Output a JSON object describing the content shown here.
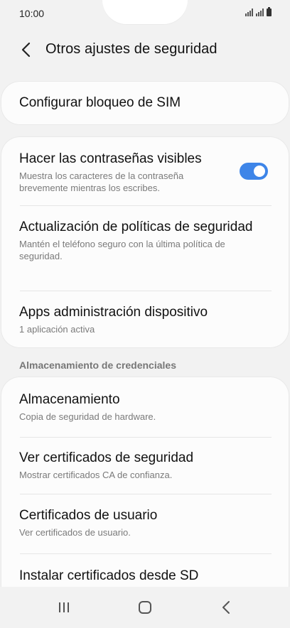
{
  "status_bar": {
    "time": "10:00",
    "icons": [
      "signal-icon",
      "signal-icon",
      "battery-icon"
    ]
  },
  "header": {
    "title": "Otros ajustes de seguridad",
    "back_icon": "chevron-left-icon"
  },
  "sim_card": {
    "title": "Configurar bloqueo de SIM"
  },
  "security_items": [
    {
      "title": "Hacer las contraseñas visibles",
      "subtitle": "Muestra los caracteres de la contraseña brevemente mientras los escribes.",
      "toggle": true
    },
    {
      "title": "Actualización de políticas de seguridad",
      "subtitle": "Mantén el teléfono seguro con la última política de seguridad."
    },
    {
      "title": "Apps administración dispositivo",
      "subtitle": "1 aplicación activa"
    }
  ],
  "credentials": {
    "section_label": "Almacenamiento de credenciales",
    "items": [
      {
        "title": "Almacenamiento",
        "subtitle": "Copia de seguridad de hardware."
      },
      {
        "title": "Ver certificados de seguridad",
        "subtitle": "Mostrar certificados CA de confianza."
      },
      {
        "title": "Certificados de usuario",
        "subtitle": "Ver certificados de usuario."
      },
      {
        "title": "Instalar certificados desde SD"
      }
    ]
  },
  "nav_bar": {
    "icons": [
      "recent-apps-icon",
      "home-icon",
      "back-icon"
    ]
  },
  "colors": {
    "background": "#f2f2f2",
    "card": "#fcfcfc",
    "accent": "#3e85e8",
    "secondary_text": "#7a7a7a"
  }
}
